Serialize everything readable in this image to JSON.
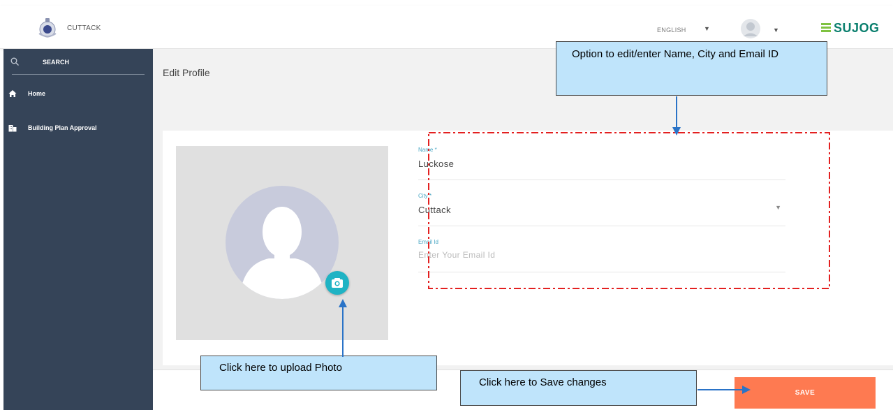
{
  "header": {
    "city_name": "CUTTACK",
    "language": "ENGLISH",
    "brand": "SUJOG",
    "brand_color": "#0a7f6e"
  },
  "sidebar": {
    "search_label": "SEARCH",
    "items": [
      {
        "label": "Home",
        "icon": "home-icon"
      },
      {
        "label": "Building Plan Approval",
        "icon": "building-icon"
      }
    ],
    "bg_color": "#354458"
  },
  "main": {
    "page_title": "Edit Profile",
    "photo": {
      "camera_icon": "camera-icon"
    },
    "fields": {
      "name": {
        "label": "Name *",
        "value": "Luckose"
      },
      "city": {
        "label": "City *",
        "value": "Cuttack"
      },
      "email": {
        "label": "Email Id",
        "placeholder": "Enter Your Email Id"
      }
    },
    "save_label": "SAVE",
    "save_color": "#fe7a51"
  },
  "annotations": {
    "edit_fields": "Option to edit/enter Name, City and Email ID",
    "upload_photo": "Click here to upload Photo",
    "save_changes": "Click here to Save changes"
  }
}
